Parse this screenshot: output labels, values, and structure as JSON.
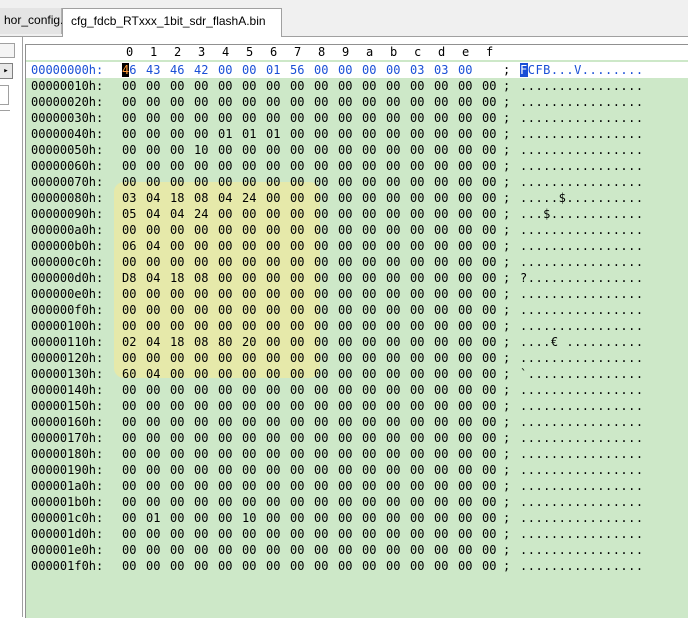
{
  "tabs": [
    {
      "label": "hor_config.c"
    },
    {
      "label": "cfg_fdcb_RTxxx_1bit_sdr_flashA.bin"
    }
  ],
  "left_pane": {
    "arrow_icon": "▸"
  },
  "hex_editor": {
    "columns": [
      "0",
      "1",
      "2",
      "3",
      "4",
      "5",
      "6",
      "7",
      "8",
      "9",
      "a",
      "b",
      "c",
      "d",
      "e",
      "f"
    ],
    "separator": ";",
    "cursor": {
      "row": 0,
      "col": 0
    },
    "rows": [
      {
        "addr": "00000000h:",
        "bytes": [
          "46",
          "43",
          "46",
          "42",
          "00",
          "00",
          "01",
          "56",
          "00",
          "00",
          "00",
          "00",
          "03",
          "03",
          "00",
          ""
        ],
        "ascii": "FCFB...V........"
      },
      {
        "addr": "00000010h:",
        "bytes": [
          "00",
          "00",
          "00",
          "00",
          "00",
          "00",
          "00",
          "00",
          "00",
          "00",
          "00",
          "00",
          "00",
          "00",
          "00",
          "00"
        ],
        "ascii": "................"
      },
      {
        "addr": "00000020h:",
        "bytes": [
          "00",
          "00",
          "00",
          "00",
          "00",
          "00",
          "00",
          "00",
          "00",
          "00",
          "00",
          "00",
          "00",
          "00",
          "00",
          "00"
        ],
        "ascii": "................"
      },
      {
        "addr": "00000030h:",
        "bytes": [
          "00",
          "00",
          "00",
          "00",
          "00",
          "00",
          "00",
          "00",
          "00",
          "00",
          "00",
          "00",
          "00",
          "00",
          "00",
          "00"
        ],
        "ascii": "................"
      },
      {
        "addr": "00000040h:",
        "bytes": [
          "00",
          "00",
          "00",
          "00",
          "01",
          "01",
          "01",
          "00",
          "00",
          "00",
          "00",
          "00",
          "00",
          "00",
          "00",
          "00"
        ],
        "ascii": "................"
      },
      {
        "addr": "00000050h:",
        "bytes": [
          "00",
          "00",
          "00",
          "10",
          "00",
          "00",
          "00",
          "00",
          "00",
          "00",
          "00",
          "00",
          "00",
          "00",
          "00",
          "00"
        ],
        "ascii": "................"
      },
      {
        "addr": "00000060h:",
        "bytes": [
          "00",
          "00",
          "00",
          "00",
          "00",
          "00",
          "00",
          "00",
          "00",
          "00",
          "00",
          "00",
          "00",
          "00",
          "00",
          "00"
        ],
        "ascii": "................"
      },
      {
        "addr": "00000070h:",
        "bytes": [
          "00",
          "00",
          "00",
          "00",
          "00",
          "00",
          "00",
          "00",
          "00",
          "00",
          "00",
          "00",
          "00",
          "00",
          "00",
          "00"
        ],
        "ascii": "................"
      },
      {
        "addr": "00000080h:",
        "bytes": [
          "03",
          "04",
          "18",
          "08",
          "04",
          "24",
          "00",
          "00",
          "00",
          "00",
          "00",
          "00",
          "00",
          "00",
          "00",
          "00"
        ],
        "ascii": ".....$.........."
      },
      {
        "addr": "00000090h:",
        "bytes": [
          "05",
          "04",
          "04",
          "24",
          "00",
          "00",
          "00",
          "00",
          "00",
          "00",
          "00",
          "00",
          "00",
          "00",
          "00",
          "00"
        ],
        "ascii": "...$............"
      },
      {
        "addr": "000000a0h:",
        "bytes": [
          "00",
          "00",
          "00",
          "00",
          "00",
          "00",
          "00",
          "00",
          "00",
          "00",
          "00",
          "00",
          "00",
          "00",
          "00",
          "00"
        ],
        "ascii": "................"
      },
      {
        "addr": "000000b0h:",
        "bytes": [
          "06",
          "04",
          "00",
          "00",
          "00",
          "00",
          "00",
          "00",
          "00",
          "00",
          "00",
          "00",
          "00",
          "00",
          "00",
          "00"
        ],
        "ascii": "................"
      },
      {
        "addr": "000000c0h:",
        "bytes": [
          "00",
          "00",
          "00",
          "00",
          "00",
          "00",
          "00",
          "00",
          "00",
          "00",
          "00",
          "00",
          "00",
          "00",
          "00",
          "00"
        ],
        "ascii": "................"
      },
      {
        "addr": "000000d0h:",
        "bytes": [
          "D8",
          "04",
          "18",
          "08",
          "00",
          "00",
          "00",
          "00",
          "00",
          "00",
          "00",
          "00",
          "00",
          "00",
          "00",
          "00"
        ],
        "ascii": "?..............."
      },
      {
        "addr": "000000e0h:",
        "bytes": [
          "00",
          "00",
          "00",
          "00",
          "00",
          "00",
          "00",
          "00",
          "00",
          "00",
          "00",
          "00",
          "00",
          "00",
          "00",
          "00"
        ],
        "ascii": "................"
      },
      {
        "addr": "000000f0h:",
        "bytes": [
          "00",
          "00",
          "00",
          "00",
          "00",
          "00",
          "00",
          "00",
          "00",
          "00",
          "00",
          "00",
          "00",
          "00",
          "00",
          "00"
        ],
        "ascii": "................"
      },
      {
        "addr": "00000100h:",
        "bytes": [
          "00",
          "00",
          "00",
          "00",
          "00",
          "00",
          "00",
          "00",
          "00",
          "00",
          "00",
          "00",
          "00",
          "00",
          "00",
          "00"
        ],
        "ascii": "................"
      },
      {
        "addr": "00000110h:",
        "bytes": [
          "02",
          "04",
          "18",
          "08",
          "80",
          "20",
          "00",
          "00",
          "00",
          "00",
          "00",
          "00",
          "00",
          "00",
          "00",
          "00"
        ],
        "ascii": "....€ .........."
      },
      {
        "addr": "00000120h:",
        "bytes": [
          "00",
          "00",
          "00",
          "00",
          "00",
          "00",
          "00",
          "00",
          "00",
          "00",
          "00",
          "00",
          "00",
          "00",
          "00",
          "00"
        ],
        "ascii": "................"
      },
      {
        "addr": "00000130h:",
        "bytes": [
          "60",
          "04",
          "00",
          "00",
          "00",
          "00",
          "00",
          "00",
          "00",
          "00",
          "00",
          "00",
          "00",
          "00",
          "00",
          "00"
        ],
        "ascii": "`..............."
      },
      {
        "addr": "00000140h:",
        "bytes": [
          "00",
          "00",
          "00",
          "00",
          "00",
          "00",
          "00",
          "00",
          "00",
          "00",
          "00",
          "00",
          "00",
          "00",
          "00",
          "00"
        ],
        "ascii": "................"
      },
      {
        "addr": "00000150h:",
        "bytes": [
          "00",
          "00",
          "00",
          "00",
          "00",
          "00",
          "00",
          "00",
          "00",
          "00",
          "00",
          "00",
          "00",
          "00",
          "00",
          "00"
        ],
        "ascii": "................"
      },
      {
        "addr": "00000160h:",
        "bytes": [
          "00",
          "00",
          "00",
          "00",
          "00",
          "00",
          "00",
          "00",
          "00",
          "00",
          "00",
          "00",
          "00",
          "00",
          "00",
          "00"
        ],
        "ascii": "................"
      },
      {
        "addr": "00000170h:",
        "bytes": [
          "00",
          "00",
          "00",
          "00",
          "00",
          "00",
          "00",
          "00",
          "00",
          "00",
          "00",
          "00",
          "00",
          "00",
          "00",
          "00"
        ],
        "ascii": "................"
      },
      {
        "addr": "00000180h:",
        "bytes": [
          "00",
          "00",
          "00",
          "00",
          "00",
          "00",
          "00",
          "00",
          "00",
          "00",
          "00",
          "00",
          "00",
          "00",
          "00",
          "00"
        ],
        "ascii": "................"
      },
      {
        "addr": "00000190h:",
        "bytes": [
          "00",
          "00",
          "00",
          "00",
          "00",
          "00",
          "00",
          "00",
          "00",
          "00",
          "00",
          "00",
          "00",
          "00",
          "00",
          "00"
        ],
        "ascii": "................"
      },
      {
        "addr": "000001a0h:",
        "bytes": [
          "00",
          "00",
          "00",
          "00",
          "00",
          "00",
          "00",
          "00",
          "00",
          "00",
          "00",
          "00",
          "00",
          "00",
          "00",
          "00"
        ],
        "ascii": "................"
      },
      {
        "addr": "000001b0h:",
        "bytes": [
          "00",
          "00",
          "00",
          "00",
          "00",
          "00",
          "00",
          "00",
          "00",
          "00",
          "00",
          "00",
          "00",
          "00",
          "00",
          "00"
        ],
        "ascii": "................"
      },
      {
        "addr": "000001c0h:",
        "bytes": [
          "00",
          "01",
          "00",
          "00",
          "00",
          "10",
          "00",
          "00",
          "00",
          "00",
          "00",
          "00",
          "00",
          "00",
          "00",
          "00"
        ],
        "ascii": "................"
      },
      {
        "addr": "000001d0h:",
        "bytes": [
          "00",
          "00",
          "00",
          "00",
          "00",
          "00",
          "00",
          "00",
          "00",
          "00",
          "00",
          "00",
          "00",
          "00",
          "00",
          "00"
        ],
        "ascii": "................"
      },
      {
        "addr": "000001e0h:",
        "bytes": [
          "00",
          "00",
          "00",
          "00",
          "00",
          "00",
          "00",
          "00",
          "00",
          "00",
          "00",
          "00",
          "00",
          "00",
          "00",
          "00"
        ],
        "ascii": "................"
      },
      {
        "addr": "000001f0h:",
        "bytes": [
          "00",
          "00",
          "00",
          "00",
          "00",
          "00",
          "00",
          "00",
          "00",
          "00",
          "00",
          "00",
          "00",
          "00",
          "00",
          "00"
        ],
        "ascii": "................"
      }
    ]
  }
}
